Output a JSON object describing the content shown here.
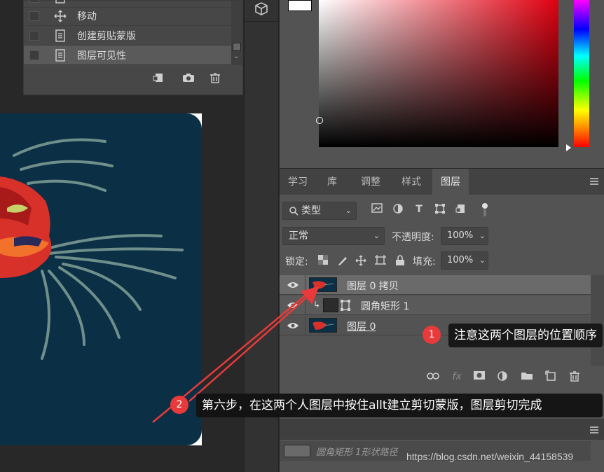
{
  "history": {
    "items": [
      {
        "label": "",
        "icon": "document-icon"
      },
      {
        "label": "移动",
        "icon": "move-icon"
      },
      {
        "label": "创建剪贴蒙版",
        "icon": "document-icon"
      },
      {
        "label": "图层可见性",
        "icon": "document-icon",
        "selected": true
      }
    ],
    "footer_icons": [
      "new-document-from-state-icon",
      "camera-icon",
      "trash-icon"
    ]
  },
  "layers_panel": {
    "tabs": [
      "学习",
      "库",
      "调整",
      "样式",
      "图层"
    ],
    "active_tab": "图层",
    "filter": {
      "label": "类型"
    },
    "blend_mode": "正常",
    "opacity_label": "不透明度:",
    "opacity_value": "100%",
    "lock_label": "锁定:",
    "fill_label": "填充:",
    "fill_value": "100%",
    "layers": [
      {
        "name": "图层 0 拷贝",
        "selected": true
      },
      {
        "name": "圆角矩形 1",
        "clipped": true
      },
      {
        "name": "图层 0"
      }
    ],
    "paths_item": "圆角矩形 1形状路径"
  },
  "annotations": [
    {
      "number": "1",
      "text": "注意这两个图层的位置顺序"
    },
    {
      "number": "2",
      "text": "第六步，在这两个人图层中按住allt建立剪切蒙版，图层剪切完成"
    }
  ],
  "watermark": "https://blog.csdn.net/weixin_44158539",
  "colors": {
    "accent_red": "#e83a3a",
    "canvas_bg": "#0b2f45",
    "panel_bg": "#535353"
  }
}
